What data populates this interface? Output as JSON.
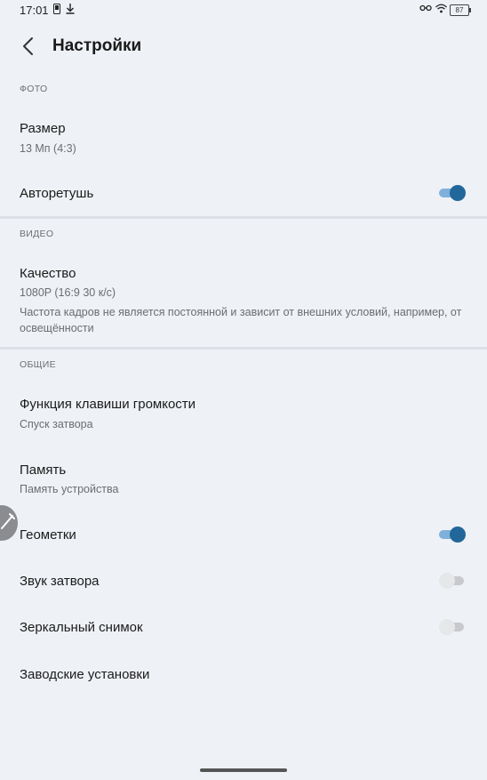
{
  "status_bar": {
    "time": "17:01",
    "battery": "87",
    "icons": [
      "sim-icon",
      "download-icon",
      "vpn-key-icon",
      "wifi-icon",
      "battery-icon"
    ]
  },
  "header": {
    "title": "Настройки",
    "back_icon": "chevron-left-icon"
  },
  "sections": {
    "photo": {
      "label": "ФОТО",
      "size": {
        "title": "Размер",
        "value": "13 Мп (4:3)"
      },
      "retouch": {
        "title": "Авторетушь",
        "enabled": true
      }
    },
    "video": {
      "label": "ВИДЕО",
      "quality": {
        "title": "Качество",
        "value": "1080P (16:9  30 к/с)",
        "description": "Частота кадров не является постоянной и зависит от внешних условий, например, от освещённости"
      }
    },
    "general": {
      "label": "ОБЩИЕ",
      "volume_key": {
        "title": "Функция клавиши громкости",
        "value": "Спуск затвора"
      },
      "memory": {
        "title": "Память",
        "value": "Память устройства"
      },
      "geotags": {
        "title": "Геометки",
        "enabled": true
      },
      "shutter_sound": {
        "title": "Звук затвора",
        "enabled": false
      },
      "mirror": {
        "title": "Зеркальный снимок",
        "enabled": false
      },
      "factory_reset": {
        "title": "Заводские установки"
      }
    }
  },
  "colors": {
    "background": "#eef1f6",
    "toggle_on_thumb": "#22679a",
    "toggle_on_track": "#7fb0d9",
    "toggle_off_thumb": "#e6e7e9",
    "toggle_off_track": "#c7c9cc"
  }
}
